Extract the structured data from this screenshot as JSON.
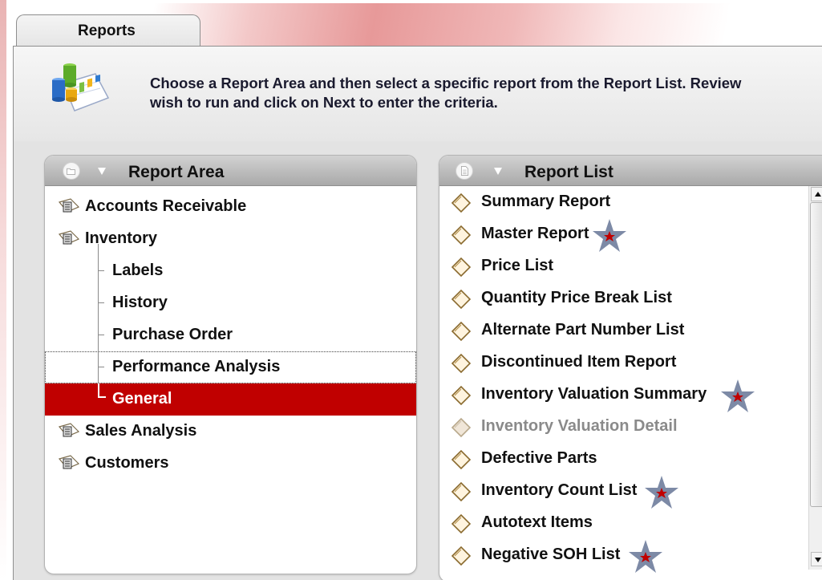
{
  "tab": {
    "label": "Reports"
  },
  "header": {
    "instruction": "Choose a Report Area and then select a specific report from the Report List. Review\nwish to run and click on Next to enter the criteria."
  },
  "report_area": {
    "title": "Report Area",
    "items": [
      {
        "label": "Accounts Receivable",
        "level": 0,
        "icon": "report-book-icon"
      },
      {
        "label": "Inventory",
        "level": 0,
        "icon": "report-book-icon"
      },
      {
        "label": "Labels",
        "level": 1
      },
      {
        "label": "History",
        "level": 1
      },
      {
        "label": "Purchase Order",
        "level": 1
      },
      {
        "label": "Performance Analysis",
        "level": 1,
        "focused": true
      },
      {
        "label": "General",
        "level": 1,
        "selected": true
      },
      {
        "label": "Sales Analysis",
        "level": 0,
        "icon": "report-book-icon"
      },
      {
        "label": "Customers",
        "level": 0,
        "icon": "report-book-icon"
      }
    ]
  },
  "report_list": {
    "title": "Report List",
    "items": [
      {
        "label": "Summary Report",
        "starred": false,
        "disabled": false
      },
      {
        "label": "Master Report",
        "starred": true,
        "disabled": false
      },
      {
        "label": "Price List",
        "starred": false,
        "disabled": false
      },
      {
        "label": "Quantity Price Break List",
        "starred": false,
        "disabled": false
      },
      {
        "label": "Alternate Part Number List",
        "starred": false,
        "disabled": false
      },
      {
        "label": "Discontinued Item Report",
        "starred": false,
        "disabled": false
      },
      {
        "label": "Inventory Valuation Summary",
        "starred": true,
        "disabled": false
      },
      {
        "label": "Inventory Valuation Detail",
        "starred": false,
        "disabled": true
      },
      {
        "label": "Defective Parts",
        "starred": false,
        "disabled": false
      },
      {
        "label": "Inventory Count List",
        "starred": true,
        "disabled": false
      },
      {
        "label": "Autotext Items",
        "starred": false,
        "disabled": false
      },
      {
        "label": "Negative SOH List",
        "starred": true,
        "disabled": false
      }
    ]
  },
  "colors": {
    "selection": "#c00000",
    "star_fill": "#7d8aa6",
    "star_center": "#c00000",
    "accent_band": "#e79999"
  }
}
